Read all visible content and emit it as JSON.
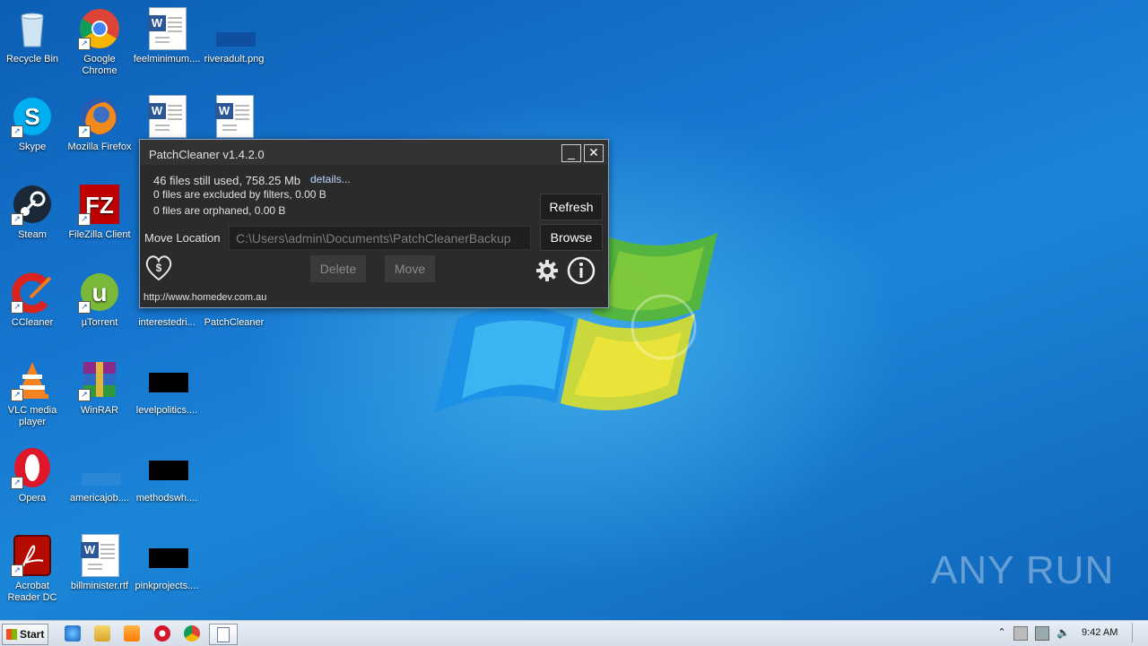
{
  "desktop": {
    "icons": [
      {
        "label": "Recycle Bin",
        "icon": "recycle-bin-icon"
      },
      {
        "label": "Google Chrome",
        "icon": "chrome-icon"
      },
      {
        "label": "feelminimum....",
        "icon": "word-document-icon"
      },
      {
        "label": "riveradult.png",
        "icon": "image-file-icon"
      },
      {
        "label": "Skype",
        "icon": "skype-icon"
      },
      {
        "label": "Mozilla Firefox",
        "icon": "firefox-icon"
      },
      {
        "label": "Steam",
        "icon": "steam-icon"
      },
      {
        "label": "FileZilla Client",
        "icon": "filezilla-icon"
      },
      {
        "label": "CCleaner",
        "icon": "ccleaner-icon"
      },
      {
        "label": "µTorrent",
        "icon": "utorrent-icon"
      },
      {
        "label": "interestedri...",
        "icon": "file-icon"
      },
      {
        "label": "PatchCleaner",
        "icon": "patchcleaner-icon"
      },
      {
        "label": "VLC media player",
        "icon": "vlc-icon"
      },
      {
        "label": "WinRAR",
        "icon": "winrar-icon"
      },
      {
        "label": "levelpolitics....",
        "icon": "image-file-icon"
      },
      {
        "label": "Opera",
        "icon": "opera-icon"
      },
      {
        "label": "americajob....",
        "icon": "image-file-icon"
      },
      {
        "label": "methodswh....",
        "icon": "image-file-icon"
      },
      {
        "label": "Acrobat Reader DC",
        "icon": "acrobat-icon"
      },
      {
        "label": "billminister.rtf",
        "icon": "word-document-icon"
      },
      {
        "label": "pinkprojects....",
        "icon": "image-file-icon"
      }
    ]
  },
  "patchcleaner": {
    "title": "PatchCleaner v1.4.2.0",
    "stats": {
      "still_used": "46 files still used, 758.25 Mb",
      "details_link": "details...",
      "excluded": "0 files are excluded by filters, 0.00 B",
      "orphaned": "0 files are orphaned, 0.00 B"
    },
    "move_location_label": "Move Location",
    "move_location_value": "C:\\Users\\admin\\Documents\\PatchCleanerBackup",
    "buttons": {
      "refresh": "Refresh",
      "browse": "Browse",
      "delete": "Delete",
      "move": "Move"
    },
    "footer_link": "http://www.homedev.com.au"
  },
  "taskbar": {
    "start_label": "Start",
    "clock": "9:42 AM"
  },
  "watermark": "ANY RUN"
}
